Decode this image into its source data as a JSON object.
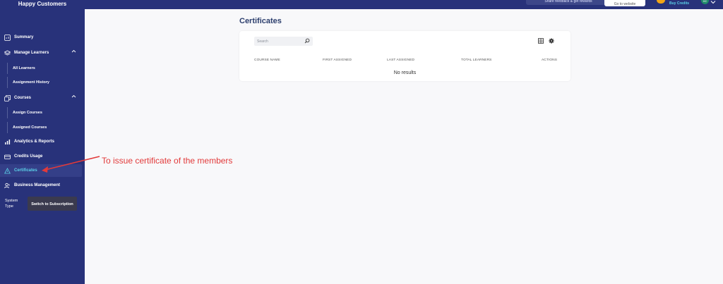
{
  "sidebar": {
    "brand": "Happy Customers",
    "items": {
      "summary": "Summary",
      "manage_learners": "Manage Learners",
      "all_learners": "All Learners",
      "assignment_history": "Assignment History",
      "courses": "Courses",
      "assign_courses": "Assign Courses",
      "assigned_courses": "Assigned Courses",
      "analytics": "Analytics & Reports",
      "credits_usage": "Credits Usage",
      "certificates": "Certificates",
      "business_management": "Business Management"
    },
    "system_type_label": "System Type",
    "switch_button": "Switch to Subscription"
  },
  "topbar": {
    "share_feedback": "Share feedback & get rewards",
    "go_to_website": "Go to website",
    "credits": "Buy Credits",
    "avatar_initials": "HC"
  },
  "main": {
    "title": "Certificates",
    "search_placeholder": "Search",
    "columns": {
      "course_name": "COURSE NAME",
      "first_assigned": "FIRST ASSIGNED",
      "last_assigned": "LAST ASSIGNED",
      "total_learners": "TOTAL LEARNERS",
      "actions": "ACTIONS"
    },
    "empty_text": "No results"
  },
  "annotation": {
    "text": "To issue certificate of the members",
    "color": "#e23a3a"
  },
  "colors": {
    "sidebar_bg": "#28327a",
    "active_text": "#5bd1e8"
  }
}
